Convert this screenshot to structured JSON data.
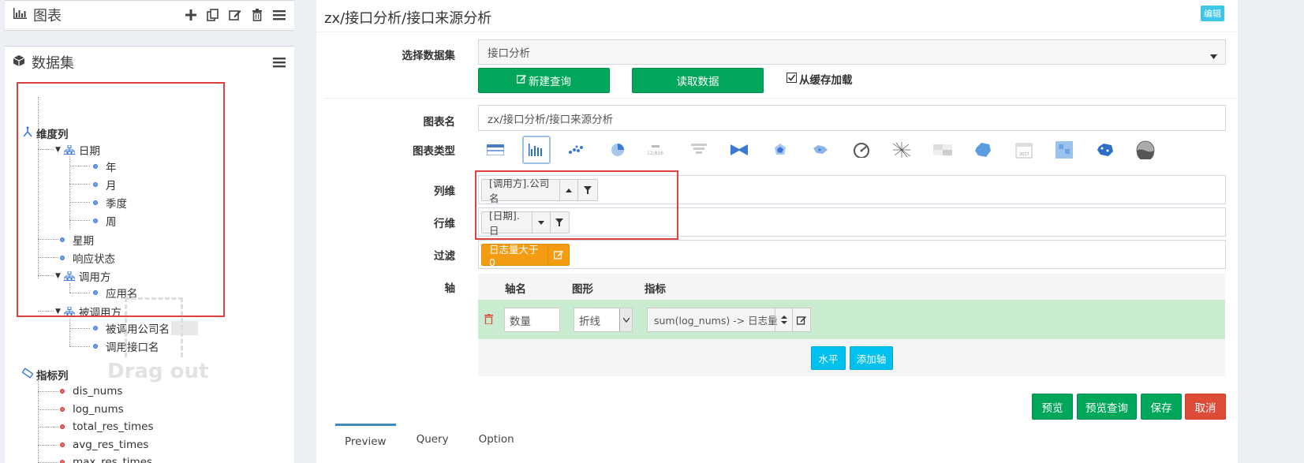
{
  "chart_panel": {
    "title": "图表"
  },
  "dataset_panel": {
    "title": "数据集",
    "dimension_root": "维度列",
    "dimensions": [
      {
        "label": "日期",
        "children": [
          "年",
          "月",
          "季度",
          "周"
        ]
      },
      {
        "label": "星期"
      },
      {
        "label": "响应状态"
      },
      {
        "label": "调用方",
        "children": [
          "应用名"
        ]
      },
      {
        "label": "被调用方",
        "children": [
          "被调用公司名",
          "调用接口名"
        ]
      }
    ],
    "drag_hint": "Drag out",
    "measure_root": "指标列",
    "measures": [
      "dis_nums",
      "log_nums",
      "total_res_times",
      "avg_res_times",
      "max_res_times"
    ]
  },
  "main": {
    "title": "zx/接口分析/接口来源分析",
    "edit_badge": "编辑",
    "dataset_label": "选择数据集",
    "dataset_value": "接口分析",
    "new_query_btn": "新建查询",
    "read_data_btn": "读取数据",
    "cache_checkbox": "从缓存加载",
    "chart_name_label": "图表名",
    "chart_name_value": "zx/接口分析/接口来源分析",
    "chart_type_label": "图表类型",
    "column_dim_label": "列维",
    "column_dim_tag": "[调用方].公司名",
    "row_dim_label": "行维",
    "row_dim_tag": "[日期].日",
    "filter_label": "过滤",
    "filter_tag": "日志量大于0",
    "axis_label": "轴",
    "axis_headers": {
      "name": "轴名",
      "shape": "图形",
      "metric": "指标"
    },
    "axis_row": {
      "name": "数量",
      "shape": "折线",
      "metric": "sum(log_nums) -> 日志量"
    },
    "btn_horizontal": "水平",
    "btn_add_axis": "添加轴",
    "btn_preview": "预览",
    "btn_preview_query": "预览查询",
    "btn_save": "保存",
    "btn_cancel": "取消",
    "tabs": [
      "Preview",
      "Query",
      "Option"
    ]
  },
  "colors": {
    "green": "#00a65a",
    "red": "#dd4b39",
    "teal": "#00c0ef",
    "orange": "#f39c12",
    "highlight": "#e04040"
  }
}
